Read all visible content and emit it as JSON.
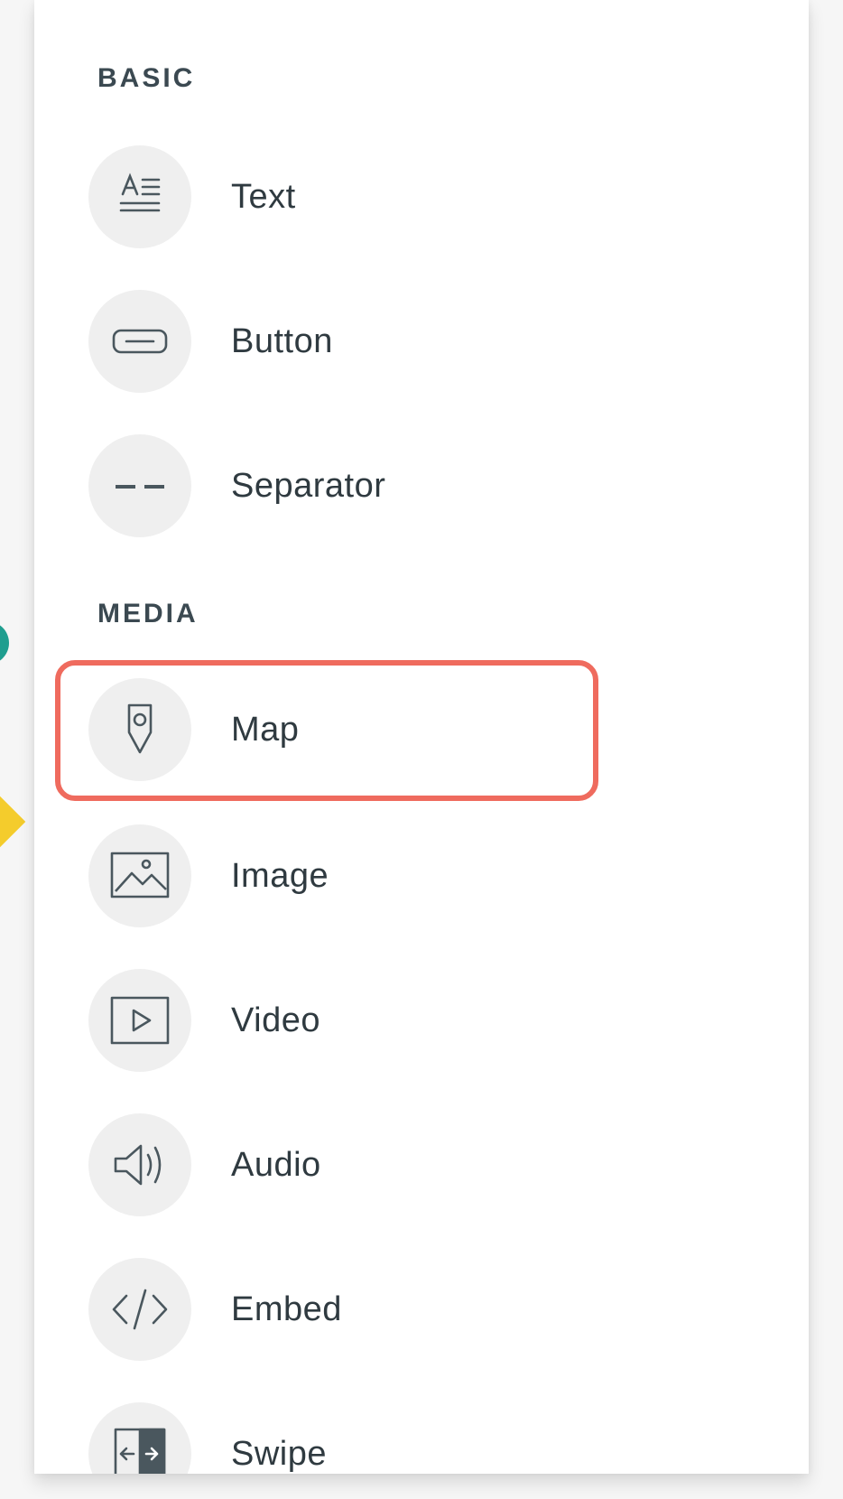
{
  "sections": [
    {
      "heading": "BASIC"
    },
    {
      "heading": "MEDIA"
    }
  ],
  "items": [
    {
      "label": "Text",
      "icon": "text-format-icon"
    },
    {
      "label": "Button",
      "icon": "button-shape-icon"
    },
    {
      "label": "Separator",
      "icon": "separator-dashes-icon"
    },
    {
      "label": "Map",
      "icon": "map-pin-icon",
      "highlighted": true
    },
    {
      "label": "Image",
      "icon": "image-landscape-icon"
    },
    {
      "label": "Video",
      "icon": "video-play-icon"
    },
    {
      "label": "Audio",
      "icon": "speaker-icon"
    },
    {
      "label": "Embed",
      "icon": "code-brackets-icon"
    },
    {
      "label": "Swipe",
      "icon": "swipe-arrow-icon"
    }
  ],
  "colors": {
    "highlight": "#ef6b5e",
    "heading": "#3b4951",
    "label": "#2f3a40",
    "icon_bg": "#efefef"
  }
}
